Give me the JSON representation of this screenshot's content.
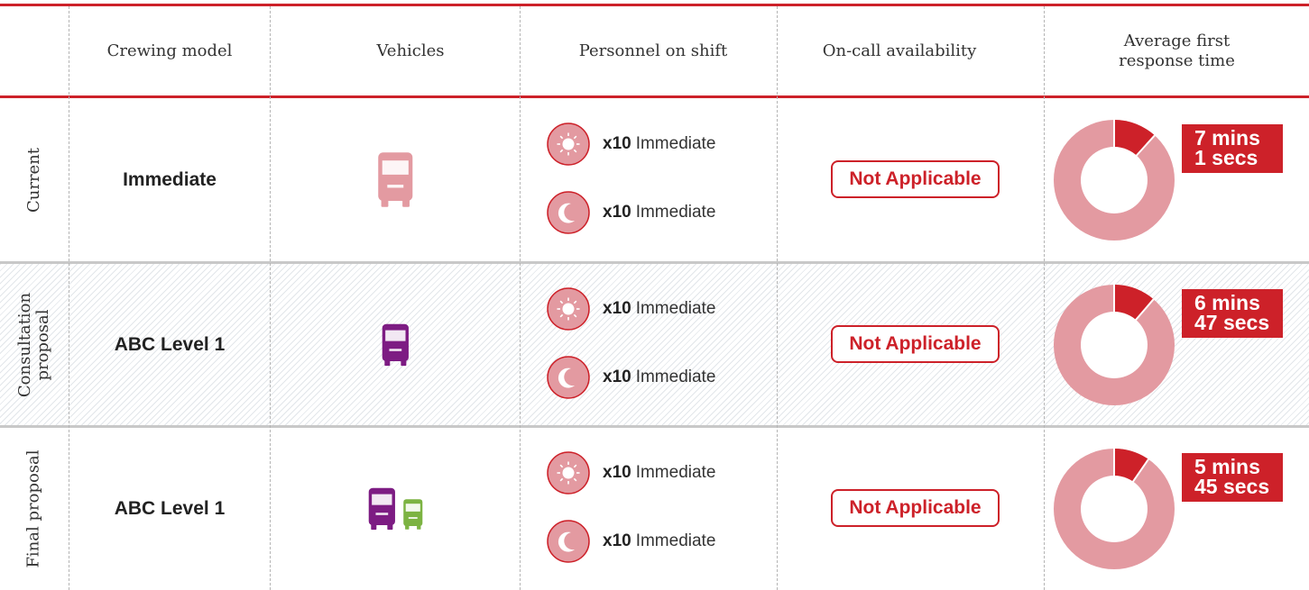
{
  "colors": {
    "accent_red": "#cd2129",
    "pale_red": "#e39aa1",
    "purple": "#7d1c83",
    "green": "#7cb342",
    "grey_line": "#c8c8c8"
  },
  "headers": {
    "crewing_model": "Crewing model",
    "vehicles": "Vehicles",
    "personnel": "Personnel on shift",
    "on_call": "On-call availability",
    "response_line1": "Average first",
    "response_line2": "response time"
  },
  "rows": [
    {
      "label": "Current",
      "crewing_model": "Immediate",
      "vehicles": [
        "pale-red-vehicle-icon"
      ],
      "personnel": [
        {
          "icon": "sun-icon",
          "count": "x10",
          "type": "Immediate"
        },
        {
          "icon": "moon-icon",
          "count": "x10",
          "type": "Immediate"
        }
      ],
      "on_call": "Not Applicable",
      "response_fraction": 0.117,
      "response_mins": "7 mins",
      "response_secs": "1 secs"
    },
    {
      "label": "Consultation\nproposal",
      "crewing_model": "ABC Level 1",
      "vehicles": [
        "purple-vehicle-icon"
      ],
      "personnel": [
        {
          "icon": "sun-icon",
          "count": "x10",
          "type": "Immediate"
        },
        {
          "icon": "moon-icon",
          "count": "x10",
          "type": "Immediate"
        }
      ],
      "on_call": "Not Applicable",
      "response_fraction": 0.113,
      "response_mins": "6 mins",
      "response_secs": "47 secs"
    },
    {
      "label": "Final proposal",
      "crewing_model": "ABC Level 1",
      "vehicles": [
        "purple-vehicle-icon",
        "green-vehicle-icon"
      ],
      "personnel": [
        {
          "icon": "sun-icon",
          "count": "x10",
          "type": "Immediate"
        },
        {
          "icon": "moon-icon",
          "count": "x10",
          "type": "Immediate"
        }
      ],
      "on_call": "Not Applicable",
      "response_fraction": 0.096,
      "response_mins": "5 mins",
      "response_secs": "45 secs"
    }
  ]
}
